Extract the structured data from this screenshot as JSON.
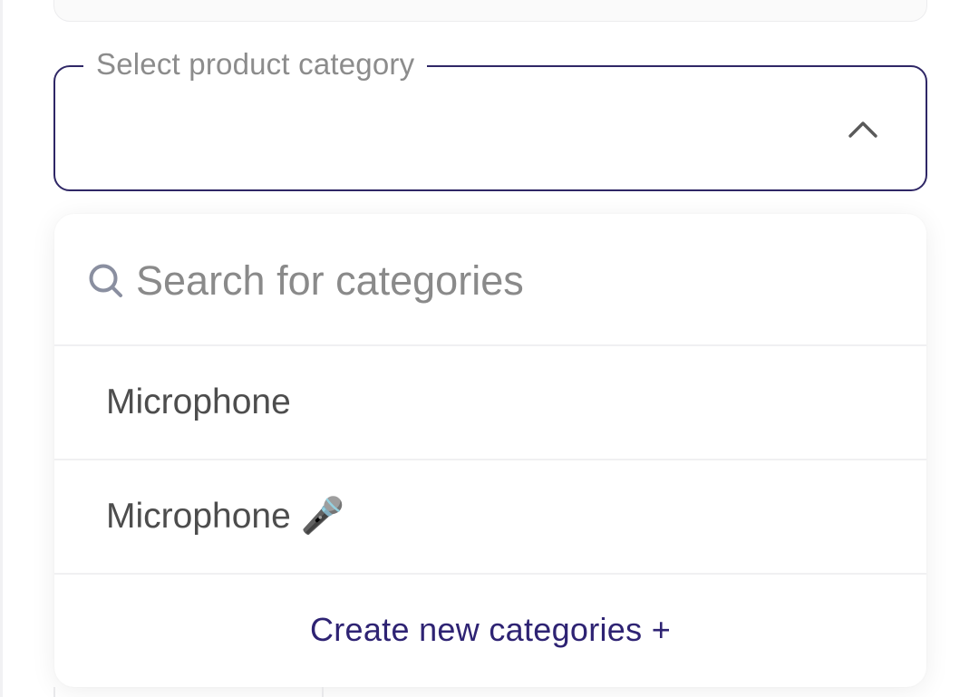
{
  "select": {
    "label": "Select product category",
    "value": "",
    "expanded": true
  },
  "dropdown": {
    "search": {
      "placeholder": "Search for categories",
      "value": ""
    },
    "options": [
      {
        "label": "Microphone"
      },
      {
        "label": "Microphone 🎤"
      }
    ],
    "create_label": "Create new categories +"
  },
  "icons": {
    "chevron": "chevron-up-icon",
    "search": "search-icon"
  },
  "colors": {
    "accent": "#2e2373",
    "border": "#2f2766",
    "label": "#8c8c8c",
    "option_text": "#4d4d4d",
    "divider": "#f0f0f2"
  }
}
